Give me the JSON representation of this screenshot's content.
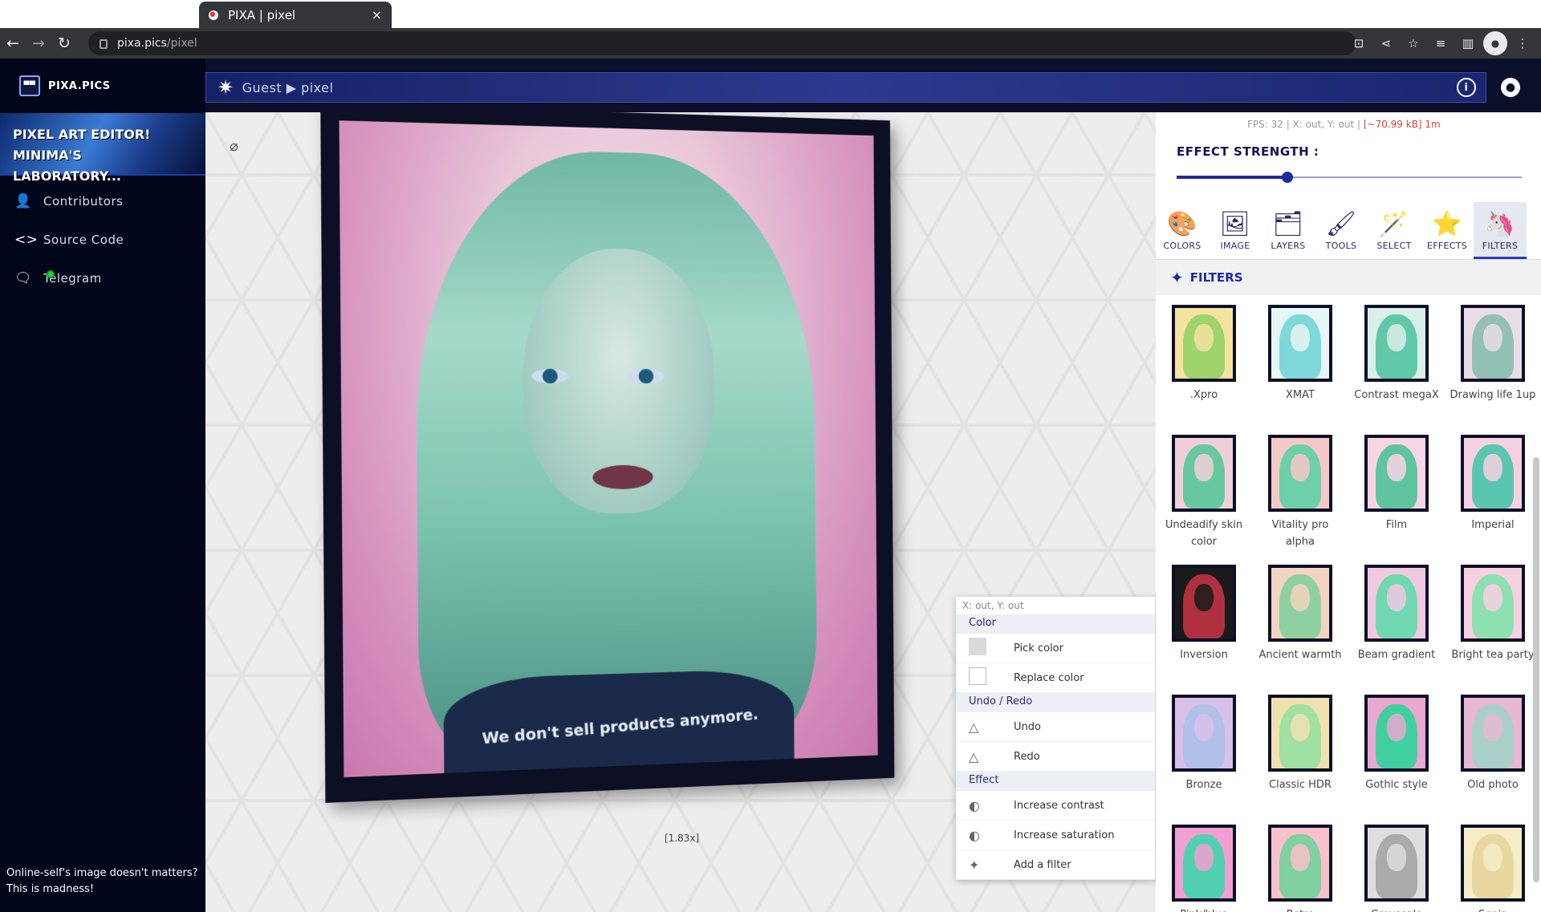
{
  "browser": {
    "tab_title": "PIXA | pixel",
    "tab_close": "×",
    "url_host": "pixa.pics",
    "url_path": "/pixel"
  },
  "sidebar": {
    "logo_text": "PIXA.PICS",
    "banner": "PIXEL ART EDITOR! MINIMA'S LABORATORY...",
    "items": [
      {
        "label": "Contributors",
        "icon": "person-icon"
      },
      {
        "label": "Source Code",
        "icon": "code-icon"
      },
      {
        "label": "Telegram",
        "icon": "chat-icon"
      }
    ],
    "footer": "Online-self's image doesn't matters? This is madness!"
  },
  "header": {
    "breadcrumb": "Guest ▶ pixel",
    "info": "i"
  },
  "canvas": {
    "shirt_text": "We don't sell products anymore.",
    "zoom": "[1.83x]"
  },
  "context_menu": {
    "coord": "X: out, Y: out",
    "sections": [
      {
        "title": "Color",
        "items": [
          "Pick color",
          "Replace color"
        ]
      },
      {
        "title": "Undo / Redo",
        "items": [
          "Undo",
          "Redo"
        ]
      },
      {
        "title": "Effect",
        "items": [
          "Increase contrast",
          "Increase saturation",
          "Add a filter"
        ]
      }
    ]
  },
  "panel": {
    "fps": "FPS: 32 | X: out, Y: out | ",
    "fps_warn": "[~70.99 kB] 1m",
    "strength_label": "EFFECT STRENGTH :",
    "strength_value": 0.32,
    "tabs": [
      "COLORS",
      "IMAGE",
      "LAYERS",
      "TOOLS",
      "SELECT",
      "EFFECTS",
      "FILTERS"
    ],
    "active_tab": "FILTERS",
    "section_title": "FILTERS",
    "filters": [
      ".Xpro",
      "XMAT",
      "Contrast megaX",
      "Drawing life 1up",
      "Undeadify skin color",
      "Vitality pro alpha",
      "Film",
      "Imperial",
      "Inversion",
      "Ancient warmth",
      "Beam gradient",
      "Bright tea party",
      "Bronze",
      "Classic HDR",
      "Gothic style",
      "Old photo",
      "Pink/blue",
      "Retro",
      "Greyscale",
      "Sepia"
    ]
  },
  "colors": {
    "accent": "#1f2aa0",
    "sidebar_bg": "#02061a",
    "warn": "#e04040"
  }
}
